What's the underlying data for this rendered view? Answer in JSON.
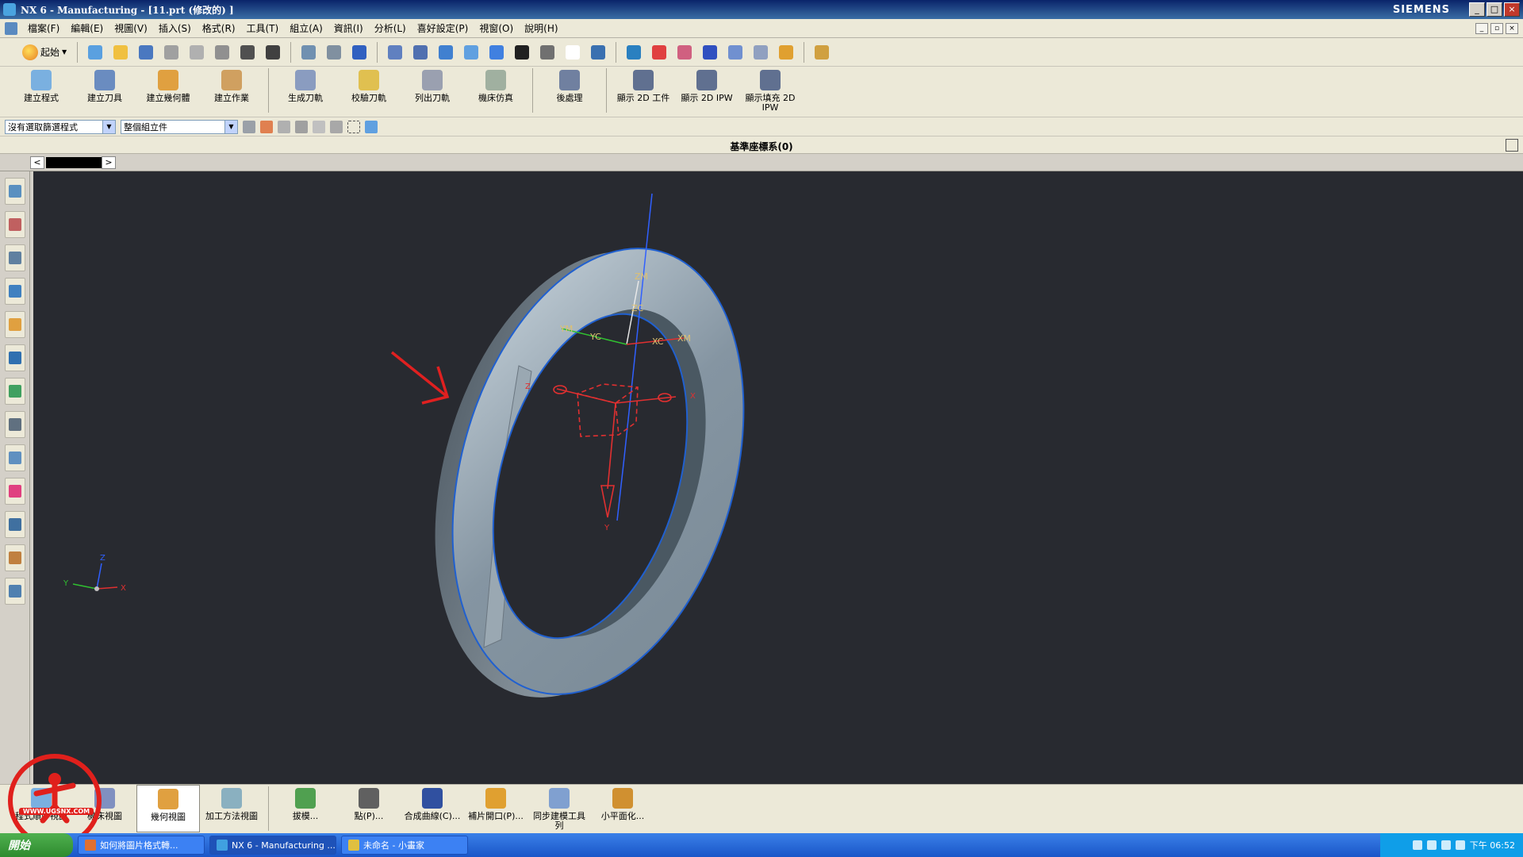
{
  "window": {
    "title": "NX 6 - Manufacturing - [11.prt (修改的) ]",
    "brand": "SIEMENS"
  },
  "menubar": {
    "items": [
      "檔案(F)",
      "編輯(E)",
      "視圖(V)",
      "插入(S)",
      "格式(R)",
      "工具(T)",
      "組立(A)",
      "資訊(I)",
      "分析(L)",
      "喜好設定(P)",
      "視窗(O)",
      "說明(H)"
    ]
  },
  "toolbar1": {
    "start_label": "起始",
    "icons": [
      "new-icon",
      "open-icon",
      "save-icon",
      "cut-icon",
      "copy-icon",
      "paste-icon",
      "delete-icon",
      "undo-icon",
      "selection-icon",
      "view-icon",
      "fit-icon",
      "zoom-window-icon",
      "zoom-icon",
      "rotate-icon",
      "pan-icon",
      "display-icon",
      "render-style-icon",
      "shading-icon",
      "background-icon",
      "layer-icon",
      "work-layer-icon",
      "snap-icon",
      "point-icon",
      "curve-icon",
      "feature-icon",
      "analysis-icon",
      "measure-icon",
      "ruler-icon"
    ]
  },
  "toolbar2": {
    "groups": [
      [
        {
          "name": "create-program",
          "label": "建立程式",
          "color": "#7ab0e0"
        },
        {
          "name": "create-tool",
          "label": "建立刀具",
          "color": "#6a8cc0"
        },
        {
          "name": "create-geometry",
          "label": "建立幾何體",
          "color": "#e0a040"
        },
        {
          "name": "create-operation",
          "label": "建立作業",
          "color": "#d0a060"
        }
      ],
      [
        {
          "name": "generate-toolpath",
          "label": "生成刀軌",
          "color": "#8a9cc0"
        },
        {
          "name": "verify-toolpath",
          "label": "校驗刀軌",
          "color": "#e0c050"
        },
        {
          "name": "list-toolpath",
          "label": "列出刀軌",
          "color": "#9aa0b0"
        },
        {
          "name": "machine-simulation",
          "label": "機床仿真",
          "color": "#a0b0a0"
        }
      ],
      [
        {
          "name": "postprocess",
          "label": "後處理",
          "color": "#7080a0"
        }
      ],
      [
        {
          "name": "show-2d-workpiece",
          "label": "顯示 2D 工件",
          "color": "#607090"
        },
        {
          "name": "show-2d-ipw",
          "label": "顯示 2D IPW",
          "color": "#607090"
        },
        {
          "name": "show-filled-2d-ipw",
          "label": "顯示填充 2D\nIPW",
          "color": "#607090"
        }
      ]
    ]
  },
  "toolbar3": {
    "filter_value": "沒有選取篩選程式",
    "scope_value": "整個組立件"
  },
  "cue": {
    "status": "基準座標系(0)"
  },
  "resource_bar": {
    "icons": [
      "assembly-navigator-icon",
      "constraint-navigator-icon",
      "part-navigator-icon",
      "operation-navigator-icon",
      "reuse-library-icon",
      "machine-tool-icon",
      "web-browser-icon",
      "history-icon",
      "system-materials-icon",
      "palette-icon",
      "process-studio-icon",
      "roles-icon",
      "system-scenes-icon"
    ]
  },
  "viewport": {
    "labels": {
      "zm": "ZM",
      "zc": "ZC",
      "ym": "YM",
      "yc": "YC",
      "xc": "XC",
      "xm": "XM",
      "mcs_z": "Z",
      "mcs_x": "X",
      "mcs_y": "Y",
      "tri_z": "Z",
      "tri_y": "Y",
      "tri_x": "X"
    },
    "colors": {
      "background": "#282a30",
      "part_face": "#8a9aa8",
      "part_edge": "#2060d0",
      "accent_red": "#e03030",
      "axis_green": "#30c030",
      "axis_blue": "#3060ff"
    }
  },
  "bottom_toolbar": {
    "buttons": [
      {
        "name": "program-order-view",
        "label": "程式順序視圖",
        "color": "#7ab0e0"
      },
      {
        "name": "machine-tool-view",
        "label": "機床視圖",
        "color": "#8090c0"
      },
      {
        "name": "geometry-view",
        "label": "幾何視圖",
        "color": "#e0a040",
        "active": true
      },
      {
        "name": "machining-method-view",
        "label": "加工方法視圖",
        "color": "#8ab0c0"
      },
      {
        "name": "draft",
        "label": "拔模...",
        "color": "#50a050"
      },
      {
        "name": "point",
        "label": "點(P)...",
        "color": "#606060"
      },
      {
        "name": "composite-curve",
        "label": "合成曲線(C)...",
        "color": "#3050a0"
      },
      {
        "name": "patch-openings",
        "label": "補片開口(P)...",
        "color": "#e0a030"
      },
      {
        "name": "synchronous-modeling",
        "label": "同步建模工具\n列",
        "color": "#80a0d0"
      },
      {
        "name": "facet",
        "label": "小平面化...",
        "color": "#d09030"
      }
    ]
  },
  "taskbar": {
    "start_label": "開始",
    "tasks": [
      {
        "label": "如何將圖片格式轉...",
        "color": "#e07030"
      },
      {
        "label": "NX 6 - Manufacturing ...",
        "color": "#40a0e0",
        "active": true
      },
      {
        "label": "未命名 - 小畫家",
        "color": "#e0c040"
      }
    ],
    "clock": "下午 06:52"
  },
  "watermark": {
    "text": "WWW.UGSNX.COM"
  }
}
